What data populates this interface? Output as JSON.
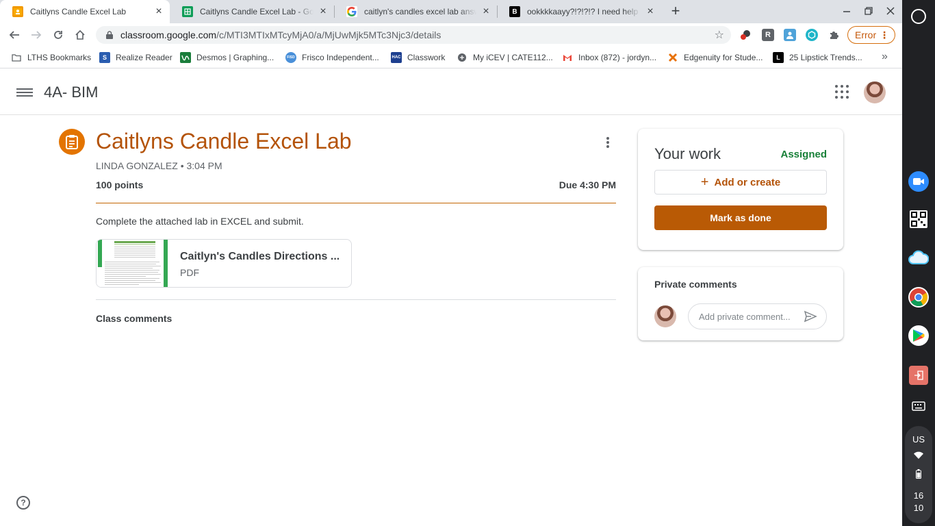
{
  "browser": {
    "tabs": [
      {
        "title": "Caitlyns Candle Excel Lab",
        "active": true
      },
      {
        "title": "Caitlyns Candle Excel Lab - Goog",
        "active": false
      },
      {
        "title": "caitlyn's candles excel lab answ",
        "active": false
      },
      {
        "title": "ookkkkaayy?!?!?!? I need help on",
        "active": false
      }
    ],
    "new_tab": "+",
    "url_host": "classroom.google.com",
    "url_path": "/c/MTI3MTIxMTcyMjA0/a/MjUwMjk5MTc3Njc3/details",
    "error_label": "Error",
    "extensions": [
      "R"
    ]
  },
  "bookmarks": [
    {
      "label": "LTHS Bookmarks",
      "icon": "folder-icon"
    },
    {
      "label": "Realize Reader",
      "icon": "realize-icon"
    },
    {
      "label": "Desmos | Graphing...",
      "icon": "desmos-icon"
    },
    {
      "label": "Frisco Independent...",
      "icon": "frisco-icon"
    },
    {
      "label": "Classwork",
      "icon": "hac-icon"
    },
    {
      "label": "My iCEV | CATE112...",
      "icon": "icev-icon"
    },
    {
      "label": "Inbox (872) - jordyn...",
      "icon": "gmail-icon"
    },
    {
      "label": "Edgenuity for Stude...",
      "icon": "edgenuity-icon"
    },
    {
      "label": "25 Lipstick Trends...",
      "icon": "lipstick-icon"
    }
  ],
  "bookmark_icon_text": {
    "frisco": "FISD",
    "hac": "HAC"
  },
  "more_bookmarks": "»",
  "classroom": {
    "class_name": "4A- BIM",
    "assignment": {
      "title": "Caitlyns Candle Excel Lab",
      "teacher_time": "LINDA GONZALEZ • 3:04 PM",
      "points": "100 points",
      "due": "Due 4:30 PM",
      "instructions": "Complete the attached lab in EXCEL and submit.",
      "attachment": {
        "name": "Caitlyn's Candles Directions ...",
        "type": "PDF"
      },
      "class_comments": "Class comments"
    },
    "your_work": {
      "title": "Your work",
      "status": "Assigned",
      "add_label": "Add or create",
      "done_label": "Mark as done"
    },
    "private_comments": {
      "title": "Private comments",
      "placeholder": "Add private comment..."
    }
  },
  "shelf": {
    "lang": "US",
    "time_hour": "16",
    "time_min": "10"
  },
  "colors": {
    "accent": "#b45309",
    "button": "#b95a05",
    "status": "#188038"
  }
}
